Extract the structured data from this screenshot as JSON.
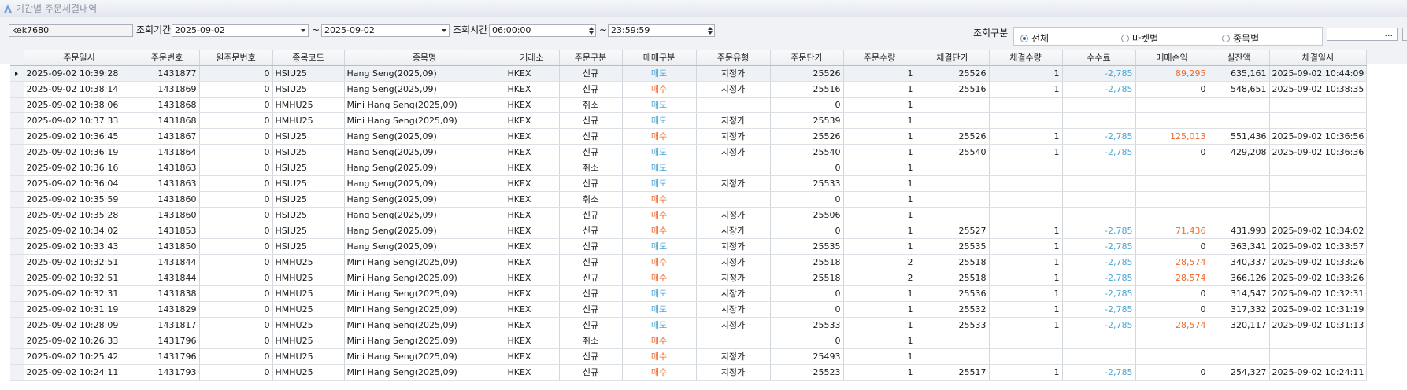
{
  "window": {
    "title": "기간별 주문체결내역"
  },
  "filters": {
    "account": "kek7680",
    "period_label": "조회기간",
    "date_from": "2025-09-02",
    "tilde": "~",
    "date_to": "2025-09-02",
    "time_label": "조회시간",
    "time_from": "06:00:00",
    "time_to": "23:59:59",
    "scope_label": "조회구분",
    "scope_options": [
      "전체",
      "마켓별",
      "종목별"
    ],
    "scope_selected": "전체",
    "more_button": "..."
  },
  "colors": {
    "buy": "#f06a2a",
    "sell": "#4aa5d6",
    "fee": "#4aa5d6",
    "profit": "#f06a2a"
  },
  "table": {
    "columns": [
      "주문일시",
      "주문번호",
      "원주문번호",
      "종목코드",
      "종목명",
      "거래소",
      "주문구분",
      "매매구분",
      "주문유형",
      "주문단가",
      "주문수량",
      "체결단가",
      "체결수량",
      "수수료",
      "매매손익",
      "실잔액",
      "체결일시"
    ],
    "rows": [
      [
        "2025-09-02 10:39:28",
        "1431877",
        "0",
        "HSIU25",
        "Hang Seng(2025,09)",
        "HKEX",
        "신규",
        "매도",
        "지정가",
        "25526",
        "1",
        "25526",
        "1",
        "-2,785",
        "89,295",
        "635,161",
        "2025-09-02 10:44:09"
      ],
      [
        "2025-09-02 10:38:14",
        "1431869",
        "0",
        "HSIU25",
        "Hang Seng(2025,09)",
        "HKEX",
        "신규",
        "매수",
        "지정가",
        "25516",
        "1",
        "25516",
        "1",
        "-2,785",
        "0",
        "548,651",
        "2025-09-02 10:38:35"
      ],
      [
        "2025-09-02 10:38:06",
        "1431868",
        "0",
        "HMHU25",
        "Mini Hang Seng(2025,09)",
        "HKEX",
        "취소",
        "매도",
        "",
        "0",
        "1",
        "",
        "",
        "",
        "",
        "",
        ""
      ],
      [
        "2025-09-02 10:37:33",
        "1431868",
        "0",
        "HMHU25",
        "Mini Hang Seng(2025,09)",
        "HKEX",
        "신규",
        "매도",
        "지정가",
        "25539",
        "1",
        "",
        "",
        "",
        "",
        "",
        ""
      ],
      [
        "2025-09-02 10:36:45",
        "1431867",
        "0",
        "HSIU25",
        "Hang Seng(2025,09)",
        "HKEX",
        "신규",
        "매수",
        "지정가",
        "25526",
        "1",
        "25526",
        "1",
        "-2,785",
        "125,013",
        "551,436",
        "2025-09-02 10:36:56"
      ],
      [
        "2025-09-02 10:36:19",
        "1431864",
        "0",
        "HSIU25",
        "Hang Seng(2025,09)",
        "HKEX",
        "신규",
        "매도",
        "지정가",
        "25540",
        "1",
        "25540",
        "1",
        "-2,785",
        "0",
        "429,208",
        "2025-09-02 10:36:36"
      ],
      [
        "2025-09-02 10:36:16",
        "1431863",
        "0",
        "HSIU25",
        "Hang Seng(2025,09)",
        "HKEX",
        "취소",
        "매도",
        "",
        "0",
        "1",
        "",
        "",
        "",
        "",
        "",
        ""
      ],
      [
        "2025-09-02 10:36:04",
        "1431863",
        "0",
        "HSIU25",
        "Hang Seng(2025,09)",
        "HKEX",
        "신규",
        "매도",
        "지정가",
        "25533",
        "1",
        "",
        "",
        "",
        "",
        "",
        ""
      ],
      [
        "2025-09-02 10:35:59",
        "1431860",
        "0",
        "HSIU25",
        "Hang Seng(2025,09)",
        "HKEX",
        "취소",
        "매수",
        "",
        "0",
        "1",
        "",
        "",
        "",
        "",
        "",
        ""
      ],
      [
        "2025-09-02 10:35:28",
        "1431860",
        "0",
        "HSIU25",
        "Hang Seng(2025,09)",
        "HKEX",
        "신규",
        "매수",
        "지정가",
        "25506",
        "1",
        "",
        "",
        "",
        "",
        "",
        ""
      ],
      [
        "2025-09-02 10:34:02",
        "1431853",
        "0",
        "HSIU25",
        "Hang Seng(2025,09)",
        "HKEX",
        "신규",
        "매수",
        "시장가",
        "0",
        "1",
        "25527",
        "1",
        "-2,785",
        "71,436",
        "431,993",
        "2025-09-02 10:34:02"
      ],
      [
        "2025-09-02 10:33:43",
        "1431850",
        "0",
        "HSIU25",
        "Hang Seng(2025,09)",
        "HKEX",
        "신규",
        "매도",
        "지정가",
        "25535",
        "1",
        "25535",
        "1",
        "-2,785",
        "0",
        "363,341",
        "2025-09-02 10:33:57"
      ],
      [
        "2025-09-02 10:32:51",
        "1431844",
        "0",
        "HMHU25",
        "Mini Hang Seng(2025,09)",
        "HKEX",
        "신규",
        "매수",
        "지정가",
        "25518",
        "2",
        "25518",
        "1",
        "-2,785",
        "28,574",
        "340,337",
        "2025-09-02 10:33:26"
      ],
      [
        "2025-09-02 10:32:51",
        "1431844",
        "0",
        "HMHU25",
        "Mini Hang Seng(2025,09)",
        "HKEX",
        "신규",
        "매수",
        "지정가",
        "25518",
        "2",
        "25518",
        "1",
        "-2,785",
        "28,574",
        "366,126",
        "2025-09-02 10:33:26"
      ],
      [
        "2025-09-02 10:32:31",
        "1431838",
        "0",
        "HMHU25",
        "Mini Hang Seng(2025,09)",
        "HKEX",
        "신규",
        "매도",
        "시장가",
        "0",
        "1",
        "25536",
        "1",
        "-2,785",
        "0",
        "314,547",
        "2025-09-02 10:32:31"
      ],
      [
        "2025-09-02 10:31:19",
        "1431829",
        "0",
        "HMHU25",
        "Mini Hang Seng(2025,09)",
        "HKEX",
        "신규",
        "매도",
        "시장가",
        "0",
        "1",
        "25532",
        "1",
        "-2,785",
        "0",
        "317,332",
        "2025-09-02 10:31:19"
      ],
      [
        "2025-09-02 10:28:09",
        "1431817",
        "0",
        "HMHU25",
        "Mini Hang Seng(2025,09)",
        "HKEX",
        "신규",
        "매도",
        "지정가",
        "25533",
        "1",
        "25533",
        "1",
        "-2,785",
        "28,574",
        "320,117",
        "2025-09-02 10:31:13"
      ],
      [
        "2025-09-02 10:26:33",
        "1431796",
        "0",
        "HMHU25",
        "Mini Hang Seng(2025,09)",
        "HKEX",
        "취소",
        "매수",
        "",
        "0",
        "1",
        "",
        "",
        "",
        "",
        "",
        ""
      ],
      [
        "2025-09-02 10:25:42",
        "1431796",
        "0",
        "HMHU25",
        "Mini Hang Seng(2025,09)",
        "HKEX",
        "신규",
        "매수",
        "지정가",
        "25493",
        "1",
        "",
        "",
        "",
        "",
        "",
        ""
      ],
      [
        "2025-09-02 10:24:11",
        "1431793",
        "0",
        "HMHU25",
        "Mini Hang Seng(2025,09)",
        "HKEX",
        "신규",
        "매수",
        "지정가",
        "25523",
        "1",
        "25517",
        "1",
        "-2,785",
        "0",
        "254,327",
        "2025-09-02 10:24:11"
      ]
    ]
  }
}
